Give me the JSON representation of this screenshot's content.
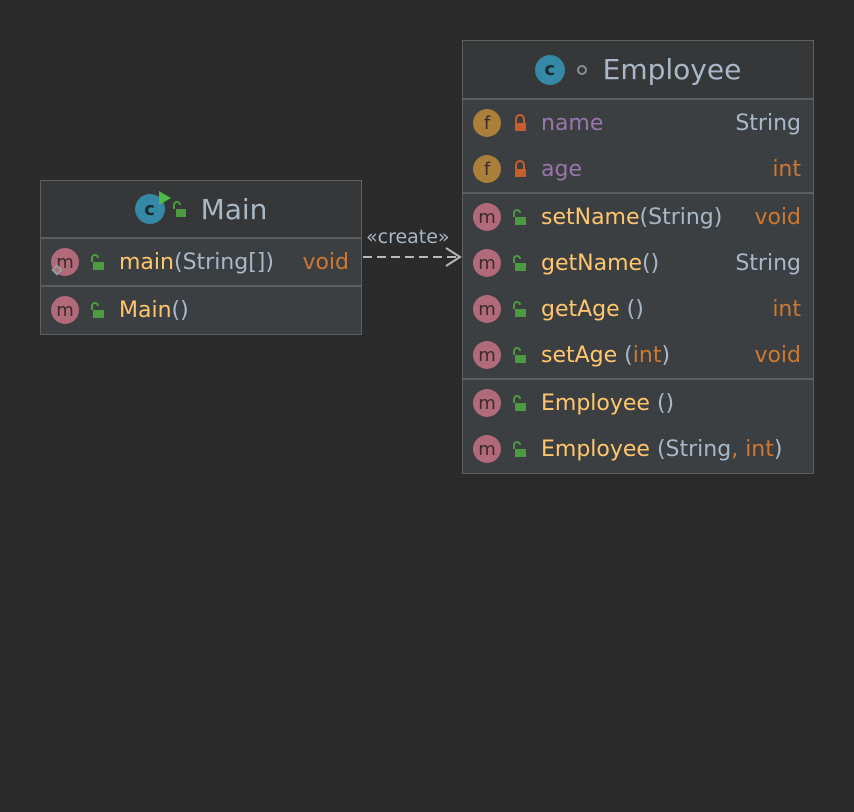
{
  "colors": {
    "background": "#2b2b2b",
    "box": "#3c3f41",
    "method_name": "#ffc66d",
    "field_name": "#9876aa",
    "type": "#a9b7c6",
    "keyword": "#cc7832",
    "class_icon": "#3589a6",
    "method_badge": "#b06a7a",
    "field_badge": "#a97f3a",
    "public_lock": "#4e9a43",
    "private_lock": "#c75c2c"
  },
  "relation": {
    "label": "«create»",
    "from": "Main",
    "to": "Employee",
    "style": "dashed-arrow"
  },
  "classes": [
    {
      "id": "main",
      "name": "Main",
      "icon": "class-runnable-icon",
      "visibility_icon": "public-lock-icon",
      "sections": [
        [
          {
            "kind": "m",
            "vis": "public",
            "name": "main",
            "params": [
              {
                "t": "(",
                "k": "type"
              },
              {
                "t": "String[]",
                "k": "type"
              },
              {
                "t": ")",
                "k": "type"
              }
            ],
            "ret": "void",
            "ret_kind": "kw",
            "extra_icon": "override-icon"
          }
        ],
        [
          {
            "kind": "m",
            "vis": "public",
            "name": "Main",
            "params": [
              {
                "t": "()",
                "k": "type"
              }
            ],
            "ret": ""
          }
        ]
      ]
    },
    {
      "id": "employee",
      "name": "Employee",
      "icon": "class-icon",
      "visibility_icon": "package-private-dot-icon",
      "sections": [
        [
          {
            "kind": "f",
            "vis": "private",
            "name": "name",
            "params": [],
            "ret": "String",
            "ret_kind": "type"
          },
          {
            "kind": "f",
            "vis": "private",
            "name": "age",
            "params": [],
            "ret": "int",
            "ret_kind": "kw"
          }
        ],
        [
          {
            "kind": "m",
            "vis": "public",
            "name": "setName",
            "params": [
              {
                "t": "(String)",
                "k": "type"
              }
            ],
            "ret": "void",
            "ret_kind": "kw"
          },
          {
            "kind": "m",
            "vis": "public",
            "name": "getName",
            "params": [
              {
                "t": "()",
                "k": "type"
              }
            ],
            "ret": "String",
            "ret_kind": "type"
          },
          {
            "kind": "m",
            "vis": "public",
            "name": "getAge ",
            "params": [
              {
                "t": "()",
                "k": "type"
              }
            ],
            "ret": "int",
            "ret_kind": "kw"
          },
          {
            "kind": "m",
            "vis": "public",
            "name": "setAge ",
            "params": [
              {
                "t": "(",
                "k": "type"
              },
              {
                "t": "int",
                "k": "kw"
              },
              {
                "t": ")",
                "k": "type"
              }
            ],
            "ret": "void",
            "ret_kind": "kw"
          }
        ],
        [
          {
            "kind": "m",
            "vis": "public",
            "name": "Employee ",
            "params": [
              {
                "t": "()",
                "k": "type"
              }
            ],
            "ret": ""
          },
          {
            "kind": "m",
            "vis": "public",
            "name": "Employee ",
            "params": [
              {
                "t": "(String",
                "k": "type"
              },
              {
                "t": ", int",
                "k": "kw"
              },
              {
                "t": ")",
                "k": "type"
              }
            ],
            "ret": ""
          }
        ]
      ]
    }
  ]
}
